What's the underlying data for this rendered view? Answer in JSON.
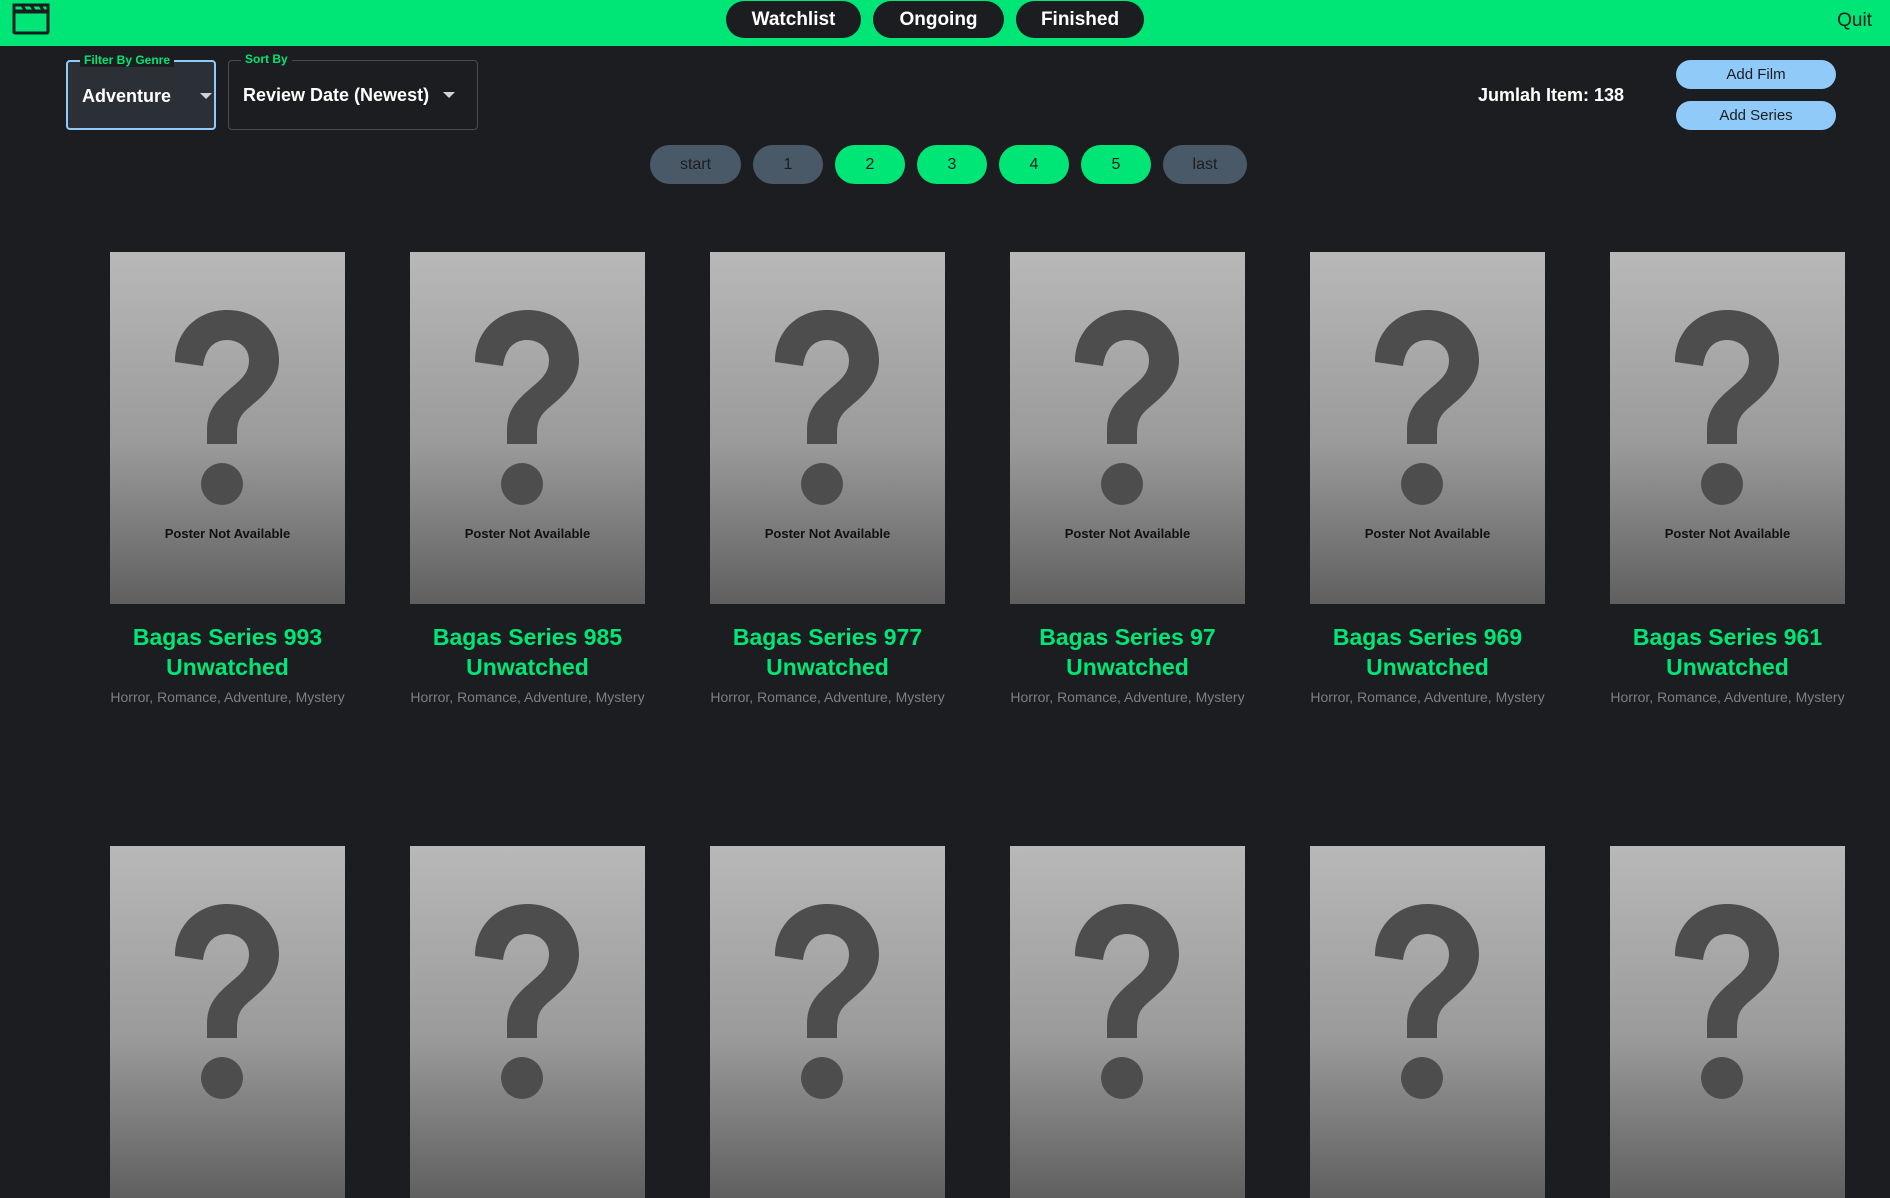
{
  "app": {
    "logo_icon": "clapperboard-icon"
  },
  "nav": {
    "tabs": [
      {
        "label": "Watchlist"
      },
      {
        "label": "Ongoing"
      },
      {
        "label": "Finished"
      }
    ],
    "quit_label": "Quit"
  },
  "filters": {
    "genre": {
      "label": "Filter By Genre",
      "value": "Adventure"
    },
    "sort": {
      "label": "Sort By",
      "value": "Review Date (Newest)"
    }
  },
  "item_count": "Jumlah Item: 138",
  "actions": {
    "add_film": "Add Film",
    "add_series": "Add Series"
  },
  "pagination": {
    "start": "start",
    "pages": [
      "1",
      "2",
      "3",
      "4",
      "5"
    ],
    "last": "last"
  },
  "poster_placeholder": "Poster Not Available",
  "cards_row1": [
    {
      "title": "Bagas Series 993",
      "status": "Unwatched",
      "genres": "Horror, Romance, Adventure, Mystery"
    },
    {
      "title": "Bagas Series 985",
      "status": "Unwatched",
      "genres": "Horror, Romance, Adventure, Mystery"
    },
    {
      "title": "Bagas Series 977",
      "status": "Unwatched",
      "genres": "Horror, Romance, Adventure, Mystery"
    },
    {
      "title": "Bagas Series 97",
      "status": "Unwatched",
      "genres": "Horror, Romance, Adventure, Mystery"
    },
    {
      "title": "Bagas Series 969",
      "status": "Unwatched",
      "genres": "Horror, Romance, Adventure, Mystery"
    },
    {
      "title": "Bagas Series 961",
      "status": "Unwatched",
      "genres": "Horror, Romance, Adventure, Mystery"
    }
  ],
  "colors": {
    "accent": "#00e676",
    "background": "#1c1d20",
    "secondary_button": "#90caf9",
    "pager_inactive": "#4a5968"
  }
}
